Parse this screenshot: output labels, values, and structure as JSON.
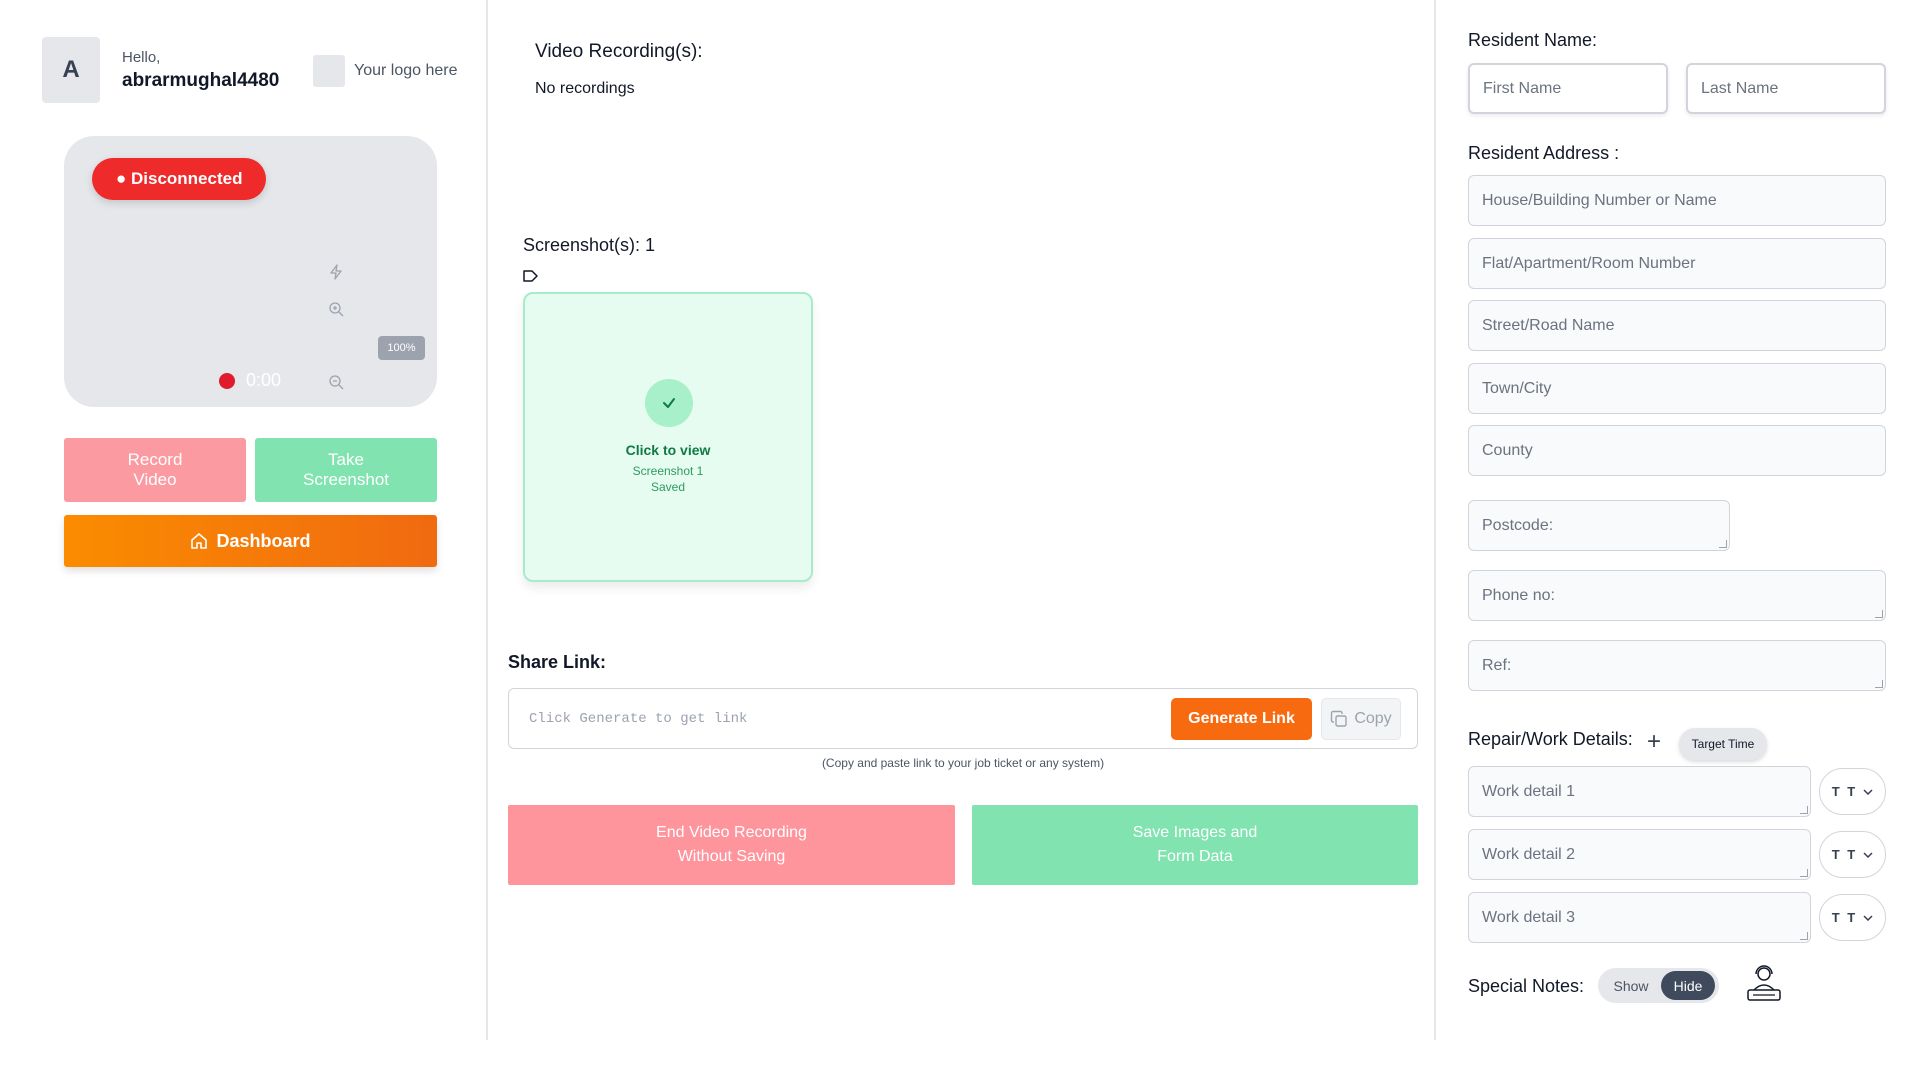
{
  "user": {
    "initial": "A",
    "greeting": "Hello,",
    "username": "abrarmughal4480"
  },
  "logo": {
    "text": "Your logo here"
  },
  "camera": {
    "status": "● Disconnected",
    "zoom": "100%",
    "timer": "0:00"
  },
  "left_buttons": {
    "record_line1": "Record",
    "record_line2": "Video",
    "screenshot_line1": "Take",
    "screenshot_line2": "Screenshot",
    "dashboard": "Dashboard"
  },
  "recordings": {
    "title": "Video Recording(s):",
    "empty": "No recordings"
  },
  "screenshots": {
    "title": "Screenshot(s): 1",
    "card": {
      "action": "Click to view",
      "name": "Screenshot 1",
      "status": "Saved"
    }
  },
  "share": {
    "title": "Share Link:",
    "placeholder": "Click Generate to get link",
    "generate": "Generate Link",
    "copy": "Copy",
    "hint": "(Copy and paste link to your job ticket or any system)"
  },
  "actions": {
    "end_line1": "End Video Recording",
    "end_line2": "Without Saving",
    "save_line1": "Save Images and",
    "save_line2": "Form Data"
  },
  "form": {
    "resident_name_label": "Resident Name:",
    "first_name_placeholder": "First Name",
    "last_name_placeholder": "Last Name",
    "address_label": "Resident Address :",
    "house_placeholder": "House/Building Number or Name",
    "flat_placeholder": "Flat/Apartment/Room Number",
    "street_placeholder": "Street/Road Name",
    "town_placeholder": "Town/City",
    "county_placeholder": "County",
    "postcode_placeholder": "Postcode:",
    "phone_placeholder": "Phone no:",
    "ref_placeholder": "Ref:",
    "repair_label": "Repair/Work Details:",
    "target_time": "Target Time",
    "work_details": [
      "Work detail 1",
      "Work detail 2",
      "Work detail 3"
    ],
    "tt_label": "T T",
    "special_notes_label": "Special Notes:",
    "toggle_show": "Show",
    "toggle_hide": "Hide"
  },
  "colors": {
    "disconnected": "#ef2a2a",
    "accent_orange": "#f76a10",
    "success_green": "#80e3b0",
    "danger_pink": "#fe959c"
  }
}
